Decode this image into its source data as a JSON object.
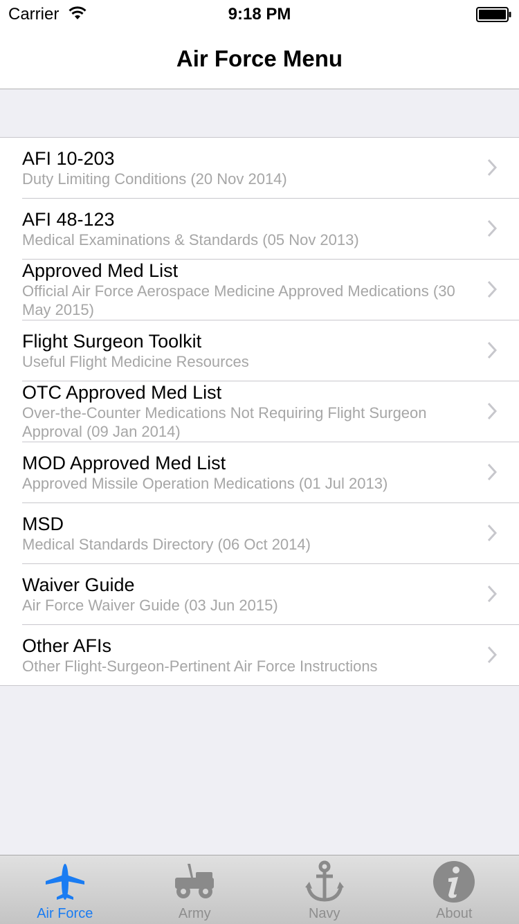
{
  "status_bar": {
    "carrier": "Carrier",
    "time": "9:18 PM"
  },
  "nav": {
    "title": "Air Force Menu"
  },
  "menu_items": [
    {
      "title": "AFI 10-203",
      "subtitle": "Duty Limiting Conditions (20 Nov 2014)"
    },
    {
      "title": "AFI 48-123",
      "subtitle": "Medical Examinations & Standards (05 Nov 2013)"
    },
    {
      "title": "Approved Med List",
      "subtitle": "Official Air Force Aerospace Medicine Approved Medications (30 May 2015)"
    },
    {
      "title": "Flight Surgeon Toolkit",
      "subtitle": "Useful Flight Medicine Resources"
    },
    {
      "title": "OTC Approved Med List",
      "subtitle": "Over-the-Counter Medications Not Requiring Flight Surgeon Approval (09 Jan 2014)"
    },
    {
      "title": "MOD Approved Med List",
      "subtitle": "Approved Missile Operation Medications (01 Jul 2013)"
    },
    {
      "title": "MSD",
      "subtitle": "Medical Standards Directory (06 Oct 2014)"
    },
    {
      "title": "Waiver Guide",
      "subtitle": "Air Force Waiver Guide (03 Jun 2015)"
    },
    {
      "title": "Other AFIs",
      "subtitle": "Other Flight-Surgeon-Pertinent Air Force Instructions"
    }
  ],
  "tabs": [
    {
      "label": "Air Force",
      "icon": "airplane-icon",
      "active": true
    },
    {
      "label": "Army",
      "icon": "jeep-icon",
      "active": false
    },
    {
      "label": "Navy",
      "icon": "anchor-icon",
      "active": false
    },
    {
      "label": "About",
      "icon": "info-icon",
      "active": false
    }
  ],
  "colors": {
    "accent": "#1a7cf2",
    "inactive_tab": "#8e8e8e",
    "subtitle": "#a6a6a6",
    "background": "#efeff4"
  }
}
